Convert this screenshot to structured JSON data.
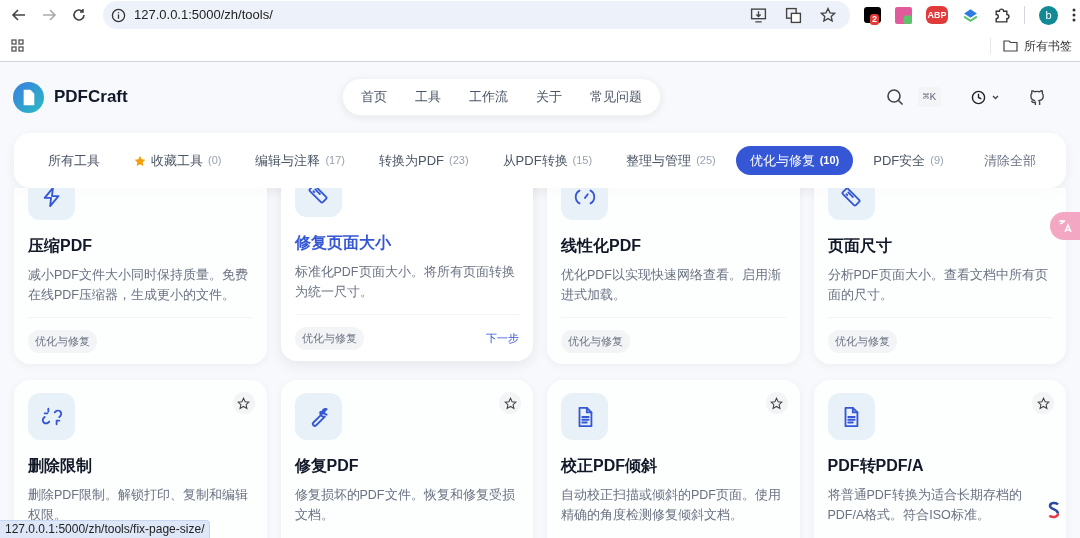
{
  "browser": {
    "url": "127.0.0.1:5000/zh/tools/",
    "extension_badge": "2",
    "adblock_label": "ABP",
    "avatar": "b",
    "bookmarks_label": "所有书签"
  },
  "header": {
    "brand": "PDFCraft",
    "nav": [
      {
        "label": "首页"
      },
      {
        "label": "工具"
      },
      {
        "label": "工作流"
      },
      {
        "label": "关于"
      },
      {
        "label": "常见问题"
      }
    ],
    "shortcut": "⌘K"
  },
  "filters": {
    "tabs": [
      {
        "label": "所有工具",
        "selected": false
      },
      {
        "label": "收藏工具",
        "count": "(0)",
        "kind": "favorites",
        "selected": false
      },
      {
        "label": "编辑与注释",
        "count": "(17)",
        "selected": false
      },
      {
        "label": "转换为PDF",
        "count": "(23)",
        "selected": false
      },
      {
        "label": "从PDF转换",
        "count": "(15)",
        "selected": false
      },
      {
        "label": "整理与管理",
        "count": "(25)",
        "selected": false
      },
      {
        "label": "优化与修复",
        "count": "(10)",
        "selected": true
      },
      {
        "label": "PDF安全",
        "count": "(9)",
        "selected": false
      }
    ],
    "clear": "清除全部"
  },
  "tools": [
    {
      "kind": "bolt",
      "title": "压缩PDF",
      "description": "减小PDF文件大小同时保持质量。免费在线PDF压缩器，生成更小的文件。",
      "tag": "优化与修复",
      "hovered": false
    },
    {
      "kind": "ruler",
      "title": "修复页面大小",
      "description": "标准化PDF页面大小。将所有页面转换为统一尺寸。",
      "tag": "优化与修复",
      "hovered": true,
      "link": "下一步"
    },
    {
      "kind": "gauge",
      "title": "线性化PDF",
      "description": "优化PDF以实现快速网络查看。启用渐进式加载。",
      "tag": "优化与修复",
      "hovered": false
    },
    {
      "kind": "ruler",
      "title": "页面尺寸",
      "description": "分析PDF页面大小。查看文档中所有页面的尺寸。",
      "tag": "优化与修复",
      "hovered": false
    },
    {
      "kind": "unlink",
      "title": "删除限制",
      "description": "删除PDF限制。解锁打印、复制和编辑权限。",
      "hovered": false,
      "favorite": {
        "starred": false
      }
    },
    {
      "kind": "wrench",
      "title": "修复PDF",
      "description": "修复损坏的PDF文件。恢复和修复受损文档。",
      "hovered": false,
      "favorite": {
        "starred": false
      }
    },
    {
      "kind": "file",
      "title": "校正PDF倾斜",
      "description": "自动校正扫描或倾斜的PDF页面。使用精确的角度检测修复倾斜文档。",
      "hovered": false,
      "favorite": {
        "starred": false
      }
    },
    {
      "kind": "file",
      "title": "PDF转PDF/A",
      "description": "将普通PDF转换为适合长期存档的PDF/A格式。符合ISO标准。",
      "hovered": false,
      "favorite": {
        "starred": false
      }
    }
  ],
  "status_bar": {
    "link_preview": "127.0.0.1:5000/zh/tools/fix-page-size/"
  }
}
